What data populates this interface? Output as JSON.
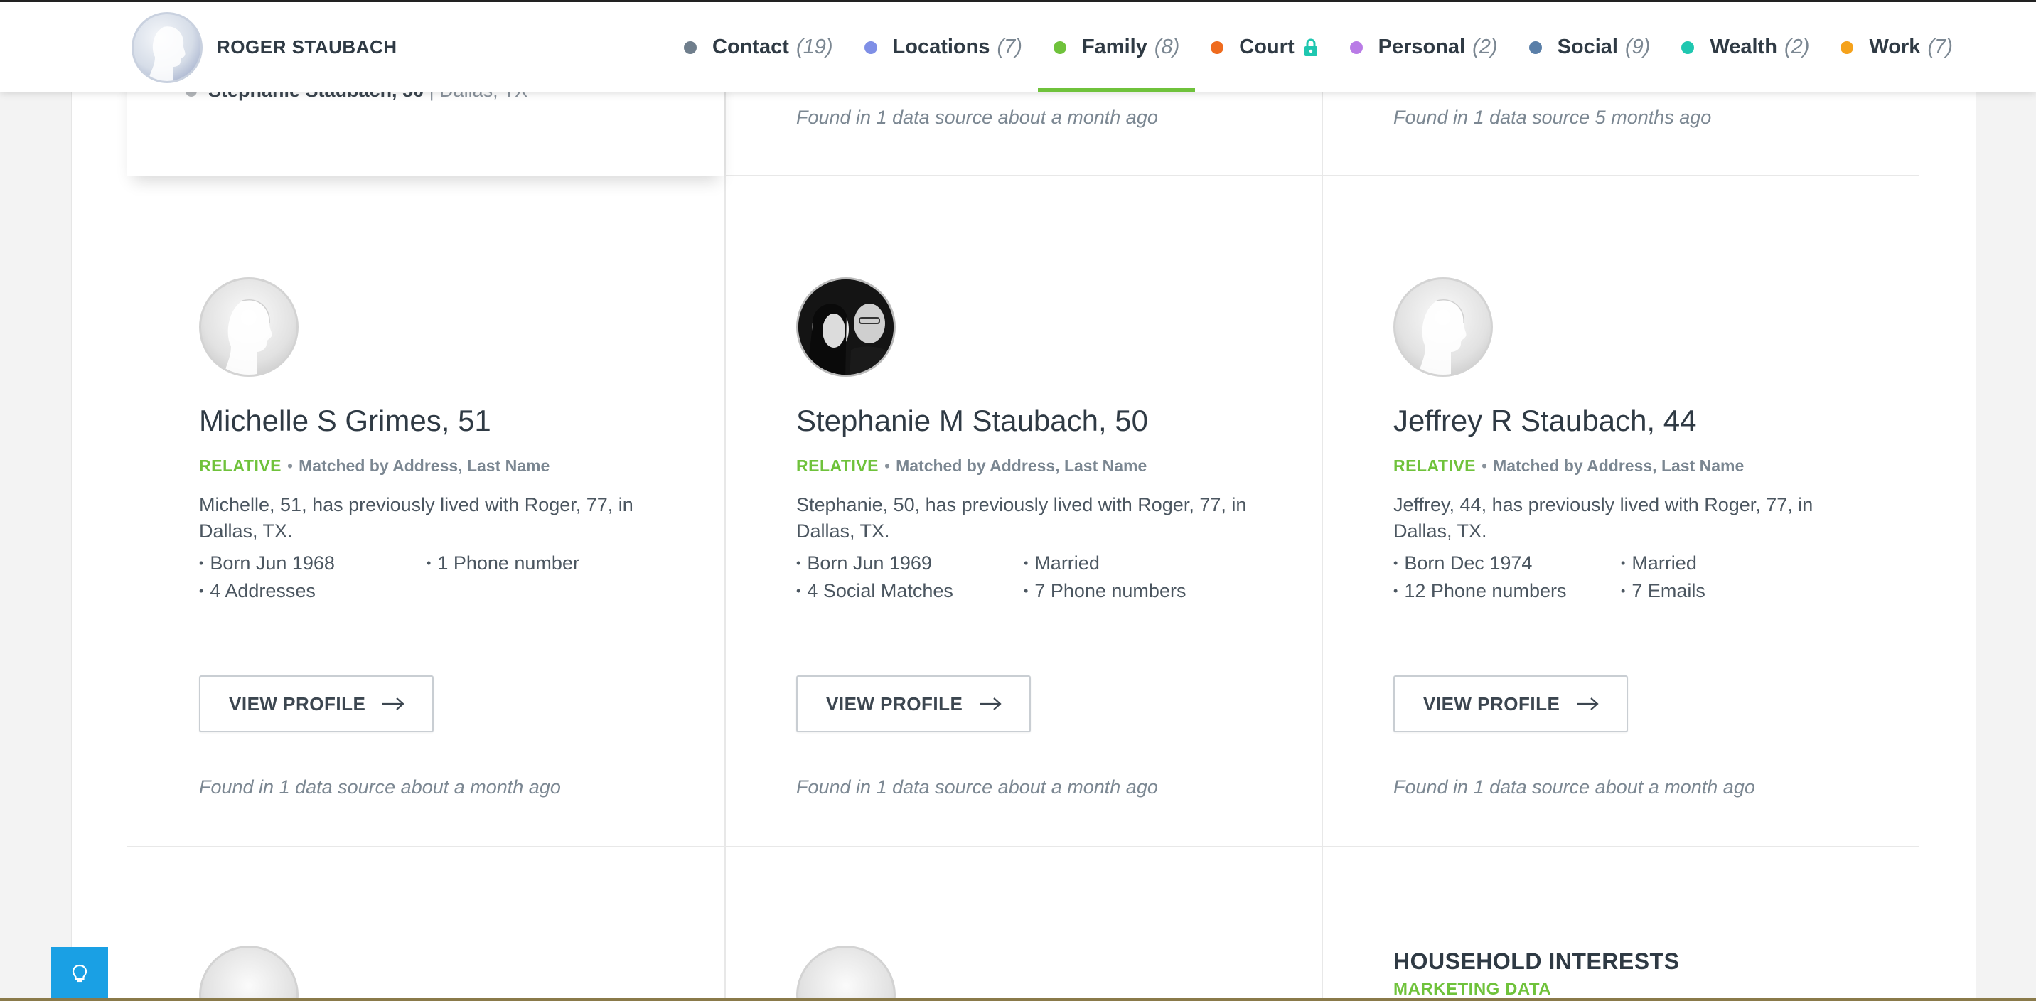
{
  "header": {
    "brand_name": "ROGER STAUBACH",
    "nav": [
      {
        "label": "Contact",
        "count": "(19)",
        "color": "#6f7e8c",
        "active": false,
        "locked": false
      },
      {
        "label": "Locations",
        "count": "(7)",
        "color": "#7f8fe6",
        "active": false,
        "locked": false
      },
      {
        "label": "Family",
        "count": "(8)",
        "color": "#6fc23b",
        "active": true,
        "locked": false
      },
      {
        "label": "Court",
        "count": "",
        "color": "#ef6b1e",
        "active": false,
        "locked": true
      },
      {
        "label": "Personal",
        "count": "(2)",
        "color": "#b97be6",
        "active": false,
        "locked": false
      },
      {
        "label": "Social",
        "count": "(9)",
        "color": "#5a7fa8",
        "active": false,
        "locked": false
      },
      {
        "label": "Wealth",
        "count": "(2)",
        "color": "#1fc7b0",
        "active": false,
        "locked": false
      },
      {
        "label": "Work",
        "count": "(7)",
        "color": "#f5a21b",
        "active": false,
        "locked": false
      }
    ]
  },
  "top_row": {
    "cut_name": "Stephanie Staubach, 50",
    "cut_location": "Dallas, TX",
    "found_1": "Found in 1 data source about a month ago",
    "found_2": "Found in 1 data source 5 months ago"
  },
  "cards": [
    {
      "name": "Michelle S Grimes, 51",
      "relation": "RELATIVE",
      "matched": "Matched by Address, Last Name",
      "summary": "Michelle, 51, has previously lived with Roger, 77, in Dallas, TX.",
      "facts": [
        "Born Jun 1968",
        "1 Phone number",
        "4 Addresses"
      ],
      "button": "VIEW PROFILE",
      "found": "Found in 1 data source about a month ago"
    },
    {
      "name": "Stephanie M Staubach, 50",
      "relation": "RELATIVE",
      "matched": "Matched by Address, Last Name",
      "summary": "Stephanie, 50, has previously lived with Roger, 77, in Dallas, TX.",
      "facts": [
        "Born Jun 1969",
        "Married",
        "4 Social Matches",
        "7 Phone numbers"
      ],
      "button": "VIEW PROFILE",
      "found": "Found in 1 data source about a month ago"
    },
    {
      "name": "Jeffrey R Staubach, 44",
      "relation": "RELATIVE",
      "matched": "Matched by Address, Last Name",
      "summary": "Jeffrey, 44, has previously lived with Roger, 77, in Dallas, TX.",
      "facts": [
        "Born Dec 1974",
        "Married",
        "12 Phone numbers",
        "7 Emails"
      ],
      "button": "VIEW PROFILE",
      "found": "Found in 1 data source about a month ago"
    }
  ],
  "household": {
    "title": "HOUSEHOLD INTERESTS",
    "subtitle": "MARKETING DATA"
  },
  "icons": {
    "help": "lightbulb-icon",
    "lock": "lock-icon",
    "arrow": "arrow-right-icon"
  }
}
